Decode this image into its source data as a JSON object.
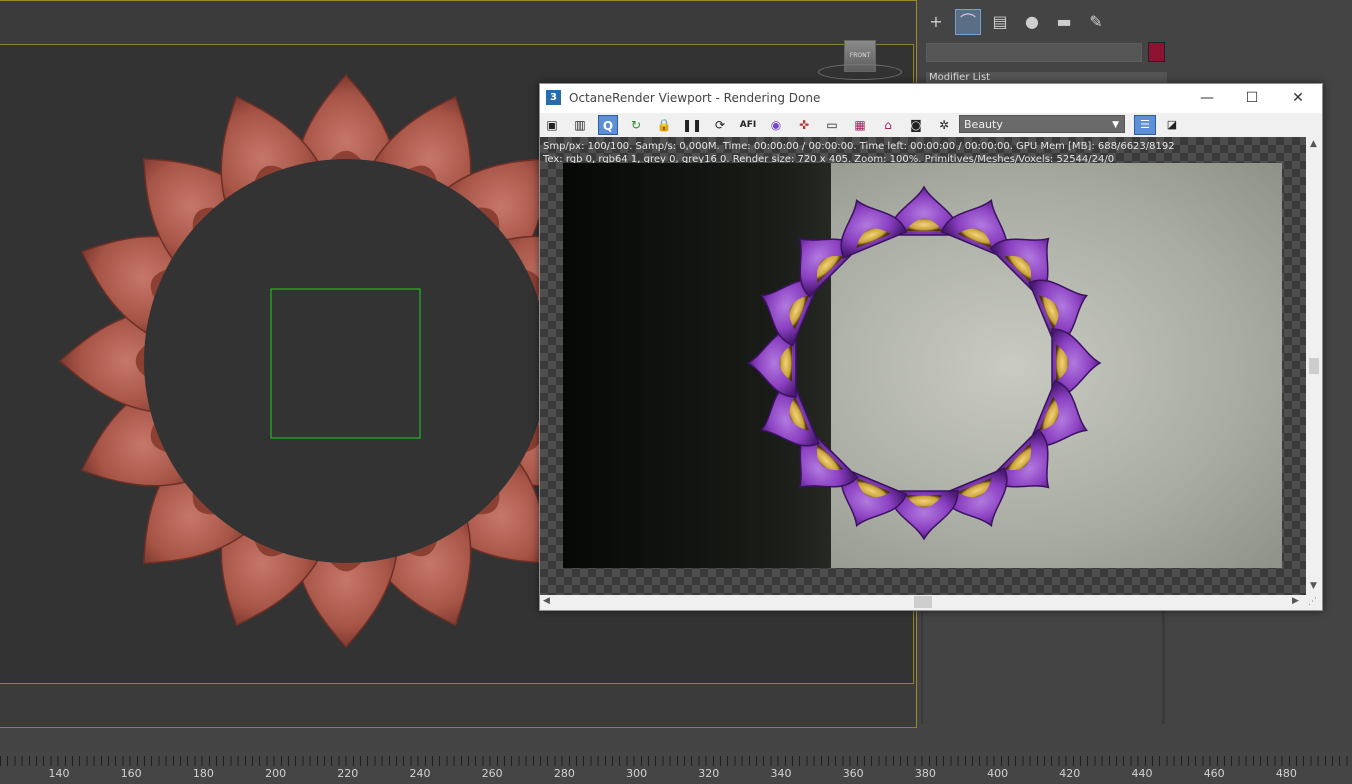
{
  "octane": {
    "title": "OctaneRender Viewport - Rendering Done",
    "app_icon": "3",
    "minimize": "—",
    "maximize": "☐",
    "close": "✕",
    "toolbar": {
      "quality_label": "Q",
      "afi_label": "AFI",
      "pass_selected": "Beauty"
    },
    "stats_line1": "Smp/px: 100/100.   Samp/s: 0,000M.   Time: 00:00:00 / 00:00:00.   Time left: 00:00:00 / 00:00:00.   GPU Mem [MB]: 688/6623/8192",
    "stats_line2": "Tex: rgb 0, rgb64 1, grey 0, grey16 0.   Render size: 720 x 405.   Zoom: 100%.   Primitives/Meshes/Voxels: 52544/24/0"
  },
  "viewport": {
    "viewcube_label": "FRONT"
  },
  "command_panel": {
    "modifier_list_label": "Modifier List",
    "object_color": "#8e1333"
  },
  "timeline": {
    "labels": [
      "140",
      "160",
      "180",
      "200",
      "220",
      "240",
      "260",
      "280",
      "300",
      "320",
      "340",
      "360",
      "380",
      "400",
      "420",
      "440",
      "460",
      "480"
    ]
  },
  "colors": {
    "petal_terracotta": "#a8574a",
    "petal_purple": "#8a3fc0",
    "petal_gold": "#c9a23a",
    "selection_box": "#22cc22",
    "frame_line": "#8f8226"
  }
}
